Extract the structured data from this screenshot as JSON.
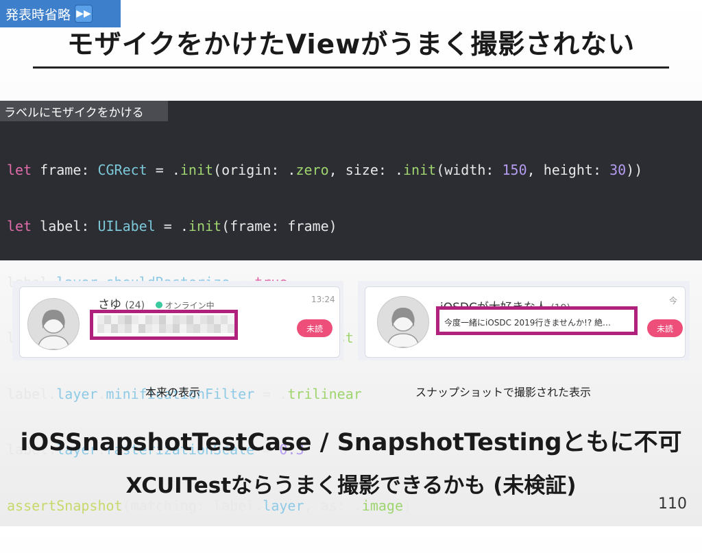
{
  "badge": {
    "label": "発表時省略",
    "icon": "fast-forward-icon"
  },
  "title": "モザイクをかけたViewがうまく撮影されない",
  "code": {
    "label": "ラベルにモザイクをかける",
    "lines": [
      "let frame: CGRect = .init(origin: .zero, size: .init(width: 150, height: 30))",
      "let label: UILabel = .init(frame: frame)",
      "label.layer.shouldRasterize = true",
      "label.layer.magnificationFilter = .nearest",
      "label.layer.minificationFilter = .trilinear",
      "label.layer.rasterizationScale = 0.3",
      "assertSnapshot(matching: label.layer, as: .image)"
    ]
  },
  "left_shot": {
    "name": "さゆ",
    "age": "(24)",
    "status": "オンライン中",
    "time": "13:24",
    "badge": "未読",
    "caption": "本来の表示"
  },
  "right_shot": {
    "name": "iOSDCが大好きな人",
    "age": "(19)",
    "time": "今",
    "message": "今度一緒にiOSDC 2019行きませんか!? 絶…",
    "badge": "未読",
    "caption": "スナップショットで撮影された表示"
  },
  "bottom": {
    "line1": "iOSSnapshotTestCase / SnapshotTestingともに不可",
    "line2": "XCUITestならうまく撮影できるかも (未検証)"
  },
  "page_number": "110",
  "colors": {
    "highlight": "#b0217d",
    "badge_bg": "#3e7fcb",
    "unread": "#ee4f7a",
    "code_bg": "#2b2d33"
  }
}
